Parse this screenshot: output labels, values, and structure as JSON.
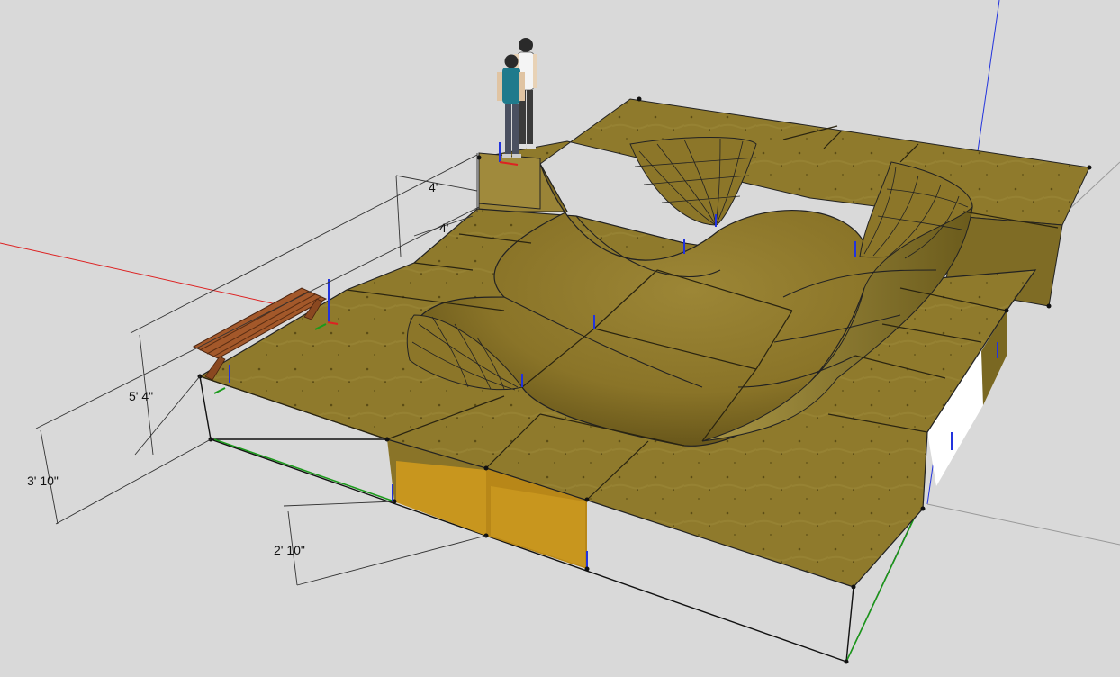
{
  "scene": {
    "colors": {
      "background": "#d9d9d9",
      "plywood": "#8f7a2c",
      "plywood_dark": "#6f5e1e",
      "plywood_light": "#a59040",
      "cavity": "#c8961e",
      "bench": "#a3582a",
      "axis_red": "#d22",
      "axis_green": "#1a9a1a",
      "axis_blue": "#2233dd"
    },
    "dimensions": {
      "width_top": "4'",
      "width_second": "4'",
      "height_platform": "5' 4\"",
      "height_deck": "3' 10\"",
      "height_cavity": "2' 10\""
    },
    "components": {
      "figures": "person-figures",
      "bench": "bench",
      "bowl": "skate-bowl"
    }
  }
}
